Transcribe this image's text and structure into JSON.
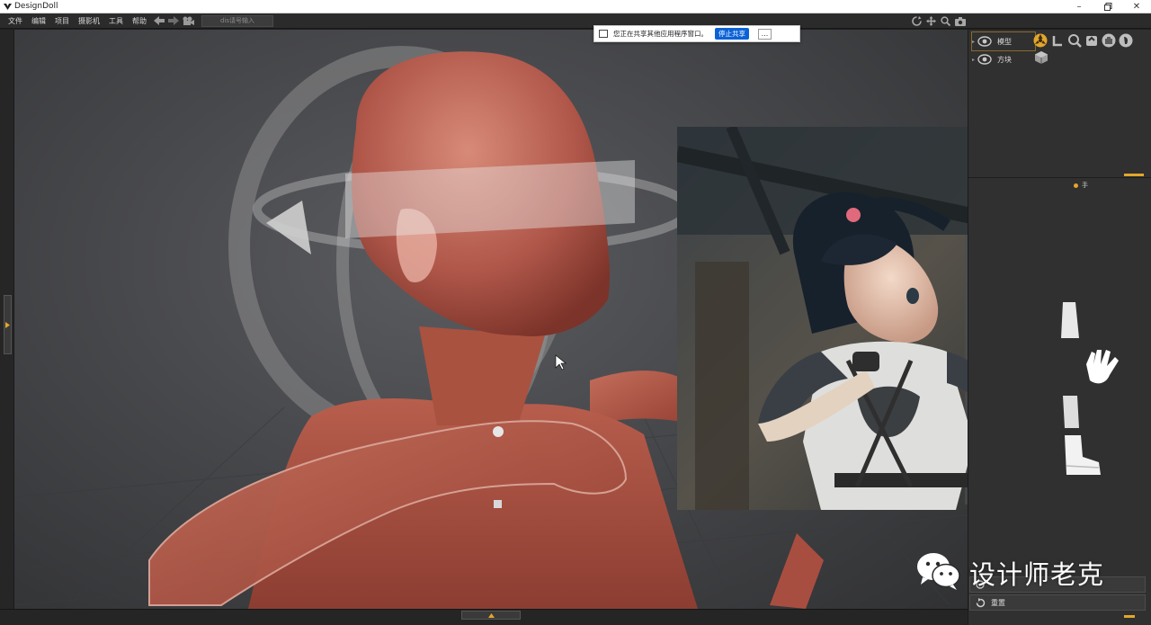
{
  "window": {
    "title": "DesignDoll"
  },
  "menu": {
    "items": [
      "文件",
      "编辑",
      "项目",
      "摄影机",
      "工具",
      "帮助"
    ],
    "search_placeholder": "dis请号输入"
  },
  "share_notice": {
    "text": "您正在共享其他应用程序窗口。",
    "stop_label": "停止共享",
    "more_label": "..."
  },
  "right_panel": {
    "scene_items": [
      {
        "label": "模型"
      },
      {
        "label": "方块"
      }
    ],
    "pose_label": "手",
    "bottom_button_label": "重置"
  },
  "watermark": {
    "text": "设计师老克"
  },
  "colors": {
    "accent": "#e3a62c",
    "share_button": "#0b62d6",
    "mannequin": "#b45a48",
    "viewport_bg": "#4b4c4f"
  },
  "icons": [
    "app-logo-icon",
    "minimize-icon",
    "maximize-icon",
    "close-icon",
    "back-arrow-icon",
    "forward-arrow-icon",
    "camera-icon",
    "rotate-icon",
    "move-icon",
    "zoom-icon",
    "screenshot-icon",
    "eye-icon",
    "hand-icon",
    "wechat-icon"
  ]
}
